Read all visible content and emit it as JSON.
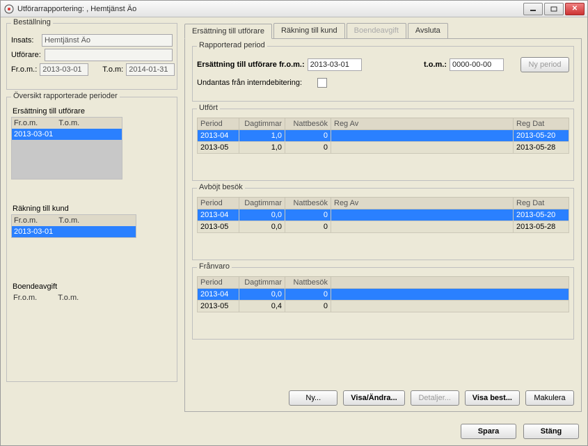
{
  "window": {
    "title_prefix": "Utförarrapportering:",
    "title_mid": "",
    "title_suffix": ", Hemtjänst Äo"
  },
  "bestallning": {
    "legend": "Beställning",
    "insats_label": "Insats:",
    "insats_value": "Hemtjänst Äo",
    "utforare_label": "Utförare:",
    "utforare_value": "",
    "from_label": "Fr.o.m.:",
    "from_value": "2013-03-01",
    "tom_label": "T.o.m:",
    "tom_value": "2014-01-31"
  },
  "oversikt": {
    "legend": "Översikt rapporterade perioder",
    "ers_label": "Ersättning till utförare",
    "ers_headers": {
      "from": "Fr.o.m.",
      "tom": "T.o.m."
    },
    "ers_rows": [
      {
        "from": "2013-03-01",
        "tom": ""
      }
    ],
    "rak_label": "Räkning till kund",
    "rak_headers": {
      "from": "Fr.o.m.",
      "tom": "T.o.m."
    },
    "rak_rows": [
      {
        "from": "2013-03-01",
        "tom": ""
      }
    ],
    "bo_label": "Boendeavgift",
    "bo_headers": {
      "from": "Fr.o.m.",
      "tom": "T.o.m."
    }
  },
  "tabs": {
    "t1": "Ersättning till utförare",
    "t2": "Räkning till kund",
    "t3": "Boendeavgift",
    "t4": "Avsluta"
  },
  "period": {
    "legend": "Rapporterad period",
    "from_label": "Ersättning till utförare fr.o.m.:",
    "from_value": "2013-03-01",
    "tom_label": "t.o.m.:",
    "tom_value": "0000-00-00",
    "ny_period": "Ny period",
    "undantas_label": "Undantas från interndebitering:"
  },
  "tables": {
    "headers": {
      "period": "Period",
      "dagtimmar": "Dagtimmar",
      "nattbesok": "Nattbesök",
      "regav": "Reg Av",
      "regdat": "Reg Dat"
    },
    "utfort": {
      "legend": "Utfört",
      "rows": [
        {
          "period": "2013-04",
          "dag": "1,0",
          "natt": "0",
          "regav": "",
          "regdat": "2013-05-20"
        },
        {
          "period": "2013-05",
          "dag": "1,0",
          "natt": "0",
          "regav": "",
          "regdat": "2013-05-28"
        }
      ]
    },
    "avbojt": {
      "legend": "Avböjt besök",
      "rows": [
        {
          "period": "2013-04",
          "dag": "0,0",
          "natt": "0",
          "regav": "",
          "regdat": "2013-05-20"
        },
        {
          "period": "2013-05",
          "dag": "0,0",
          "natt": "0",
          "regav": "",
          "regdat": "2013-05-28"
        }
      ]
    },
    "franvaro": {
      "legend": "Frånvaro",
      "rows": [
        {
          "period": "2013-04",
          "dag": "0,0",
          "natt": "0"
        },
        {
          "period": "2013-05",
          "dag": "0,4",
          "natt": "0"
        }
      ]
    }
  },
  "buttons": {
    "ny": "Ny...",
    "visa_andra": "Visa/Ändra...",
    "detaljer": "Detaljer...",
    "visa_best": "Visa best...",
    "makulera": "Makulera",
    "spara": "Spara",
    "stang": "Stäng"
  }
}
